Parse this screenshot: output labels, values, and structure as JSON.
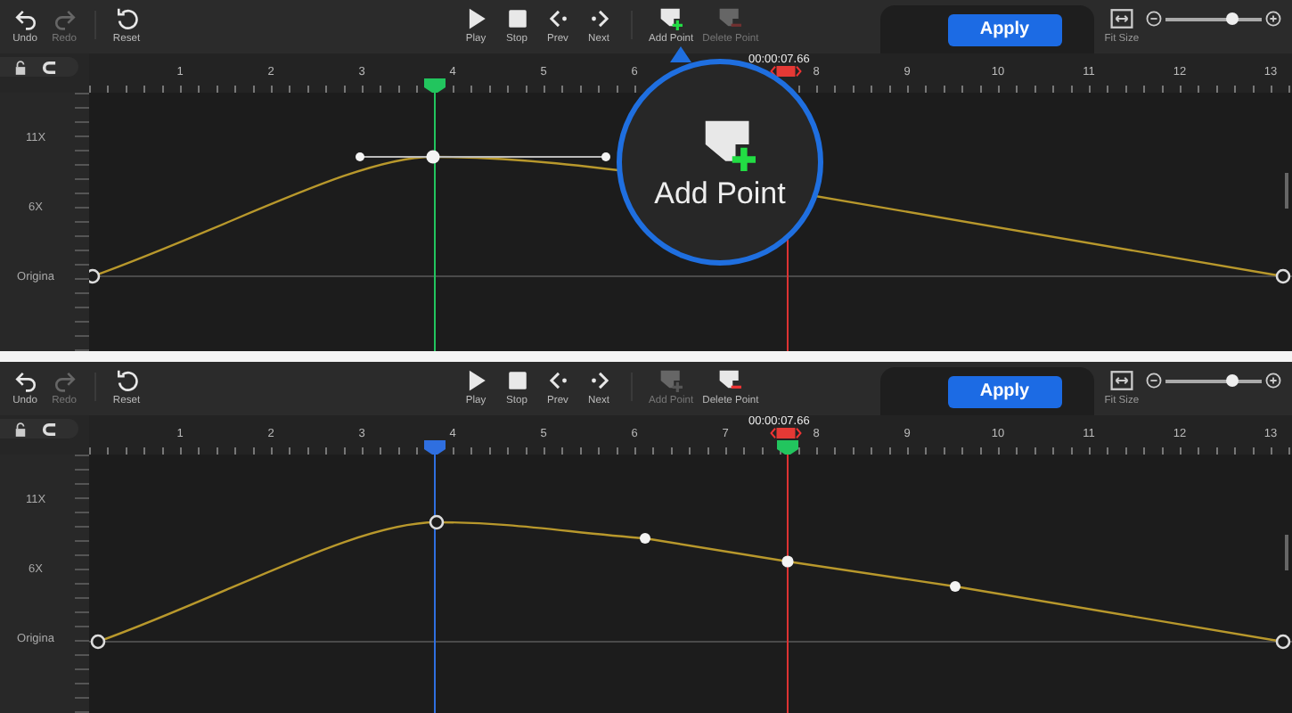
{
  "panels": [
    {
      "toolbar": {
        "left": [
          {
            "label": "Undo",
            "kind": "undo",
            "disabled": false
          },
          {
            "label": "Redo",
            "kind": "redo",
            "disabled": true
          },
          {
            "label": "Reset",
            "kind": "reset",
            "disabled": false
          }
        ],
        "center": [
          {
            "label": "Play",
            "kind": "play",
            "disabled": false
          },
          {
            "label": "Stop",
            "kind": "stop",
            "disabled": false
          },
          {
            "label": "Prev",
            "kind": "prev",
            "disabled": false
          },
          {
            "label": "Next",
            "kind": "next",
            "disabled": false
          },
          {
            "label": "Add Point",
            "kind": "add-point",
            "disabled": false
          },
          {
            "label": "Delete Point",
            "kind": "delete-point",
            "disabled": true
          }
        ],
        "apply": "Apply",
        "fit_size": "Fit Size",
        "zoom": {
          "level": 0.7
        }
      },
      "ruler": {
        "segments": [
          [
            "1",
            "2",
            "3",
            "4",
            "5",
            "6"
          ],
          [
            "8",
            "9",
            "10",
            "11",
            "12",
            "13"
          ]
        ],
        "time": "00:00:07.66",
        "markers": [
          {
            "color": "#22c55e"
          }
        ]
      },
      "axis": [
        "11X",
        "6X",
        "Origina"
      ],
      "graph": {
        "kind": "handles"
      },
      "magnifier": {
        "label": "Add Point"
      }
    },
    {
      "toolbar": {
        "left": [
          {
            "label": "Undo",
            "kind": "undo",
            "disabled": false
          },
          {
            "label": "Redo",
            "kind": "redo",
            "disabled": true
          },
          {
            "label": "Reset",
            "kind": "reset",
            "disabled": false
          }
        ],
        "center": [
          {
            "label": "Play",
            "kind": "play",
            "disabled": false
          },
          {
            "label": "Stop",
            "kind": "stop",
            "disabled": false
          },
          {
            "label": "Prev",
            "kind": "prev",
            "disabled": false
          },
          {
            "label": "Next",
            "kind": "next",
            "disabled": false
          },
          {
            "label": "Add Point",
            "kind": "add-point",
            "disabled": true
          },
          {
            "label": "Delete Point",
            "kind": "delete-point",
            "disabled": false
          }
        ],
        "apply": "Apply",
        "fit_size": "Fit Size",
        "zoom": {
          "level": 0.7
        }
      },
      "ruler": {
        "segments": [
          [
            "1",
            "2",
            "3",
            "4",
            "5",
            "6",
            "7",
            "8",
            "9",
            "10",
            "11",
            "12",
            "13"
          ]
        ],
        "time": "00:00:07.66",
        "markers": [
          {
            "color": "#2f6fe0"
          },
          {
            "color": "#22c55e"
          }
        ]
      },
      "axis": [
        "11X",
        "6X",
        "Origina"
      ],
      "graph": {
        "kind": "points"
      }
    }
  ]
}
